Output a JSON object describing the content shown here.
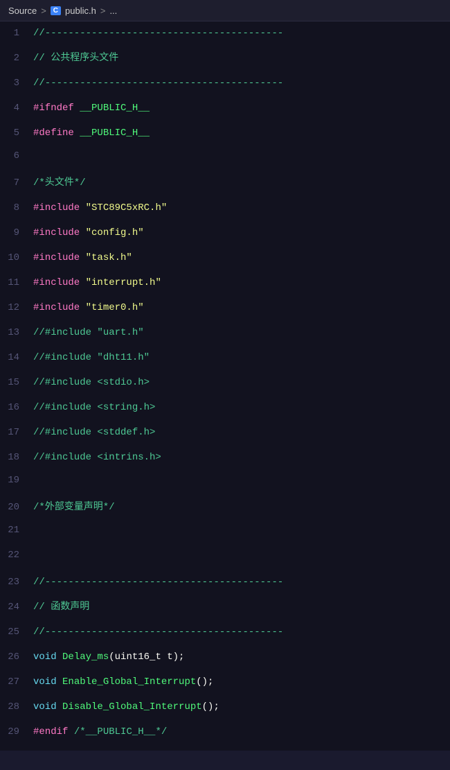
{
  "breadcrumb": {
    "source_label": "Source",
    "sep1": ">",
    "c_icon": "C",
    "file_label": "public.h",
    "sep2": ">",
    "ellipsis": "..."
  },
  "lines": [
    {
      "num": "1",
      "type": "comment_dash",
      "content": "//-----------------------------------------"
    },
    {
      "num": "2",
      "type": "comment_text",
      "content": "// 公共程序头文件"
    },
    {
      "num": "3",
      "type": "comment_dash",
      "content": "//-----------------------------------------"
    },
    {
      "num": "4",
      "type": "ifndef",
      "content": "#ifndef __PUBLIC_H__"
    },
    {
      "num": "5",
      "type": "define",
      "content": "#define __PUBLIC_H__"
    },
    {
      "num": "6",
      "type": "empty",
      "content": ""
    },
    {
      "num": "7",
      "type": "comment_text",
      "content": "/*头文件*/"
    },
    {
      "num": "8",
      "type": "include",
      "directive": "#include",
      "string": "\"STC89C5xRC.h\""
    },
    {
      "num": "9",
      "type": "include",
      "directive": "#include",
      "string": "\"config.h\""
    },
    {
      "num": "10",
      "type": "include",
      "directive": "#include",
      "string": "\"task.h\""
    },
    {
      "num": "11",
      "type": "include",
      "directive": "#include",
      "string": "\"interrupt.h\""
    },
    {
      "num": "12",
      "type": "include",
      "directive": "#include",
      "string": "\"timer0.h\""
    },
    {
      "num": "13",
      "type": "comment_include",
      "content": "//#include \"uart.h\""
    },
    {
      "num": "14",
      "type": "comment_include",
      "content": "//#include \"dht11.h\""
    },
    {
      "num": "15",
      "type": "comment_include",
      "content": "//#include <stdio.h>"
    },
    {
      "num": "16",
      "type": "comment_include",
      "content": "//#include <string.h>"
    },
    {
      "num": "17",
      "type": "comment_include",
      "content": "//#include <stddef.h>"
    },
    {
      "num": "18",
      "type": "comment_include",
      "content": "//#include <intrins.h>"
    },
    {
      "num": "19",
      "type": "empty",
      "content": ""
    },
    {
      "num": "20",
      "type": "comment_text",
      "content": "/*外部变量声明*/"
    },
    {
      "num": "21",
      "type": "empty",
      "content": ""
    },
    {
      "num": "22",
      "type": "empty",
      "content": ""
    },
    {
      "num": "23",
      "type": "comment_dash",
      "content": "//-----------------------------------------"
    },
    {
      "num": "24",
      "type": "comment_text",
      "content": "// 函数声明"
    },
    {
      "num": "25",
      "type": "comment_dash",
      "content": "//-----------------------------------------"
    },
    {
      "num": "26",
      "type": "func_decl",
      "keyword": "void",
      "func": "Delay_ms",
      "params": "(uint16_t t);"
    },
    {
      "num": "27",
      "type": "func_decl",
      "keyword": "void",
      "func": "Enable_Global_Interrupt",
      "params": "();"
    },
    {
      "num": "28",
      "type": "func_decl",
      "keyword": "void",
      "func": "Disable_Global_Interrupt",
      "params": "();"
    },
    {
      "num": "29",
      "type": "endif",
      "content": "#endif /*__PUBLIC_H__*/"
    }
  ]
}
